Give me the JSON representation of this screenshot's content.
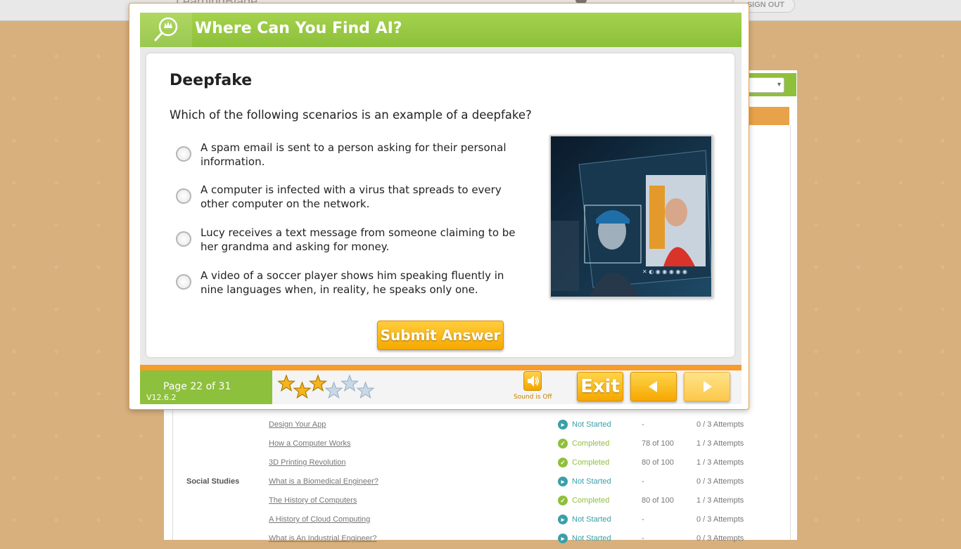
{
  "site": {
    "logo_text": "LearningBlade",
    "signout_label": "SIGN OUT"
  },
  "background_table": {
    "rows": [
      {
        "subject": "",
        "title": "Design Your App",
        "status": "Not Started",
        "status_kind": "not-started",
        "score": "-",
        "attempts": "0 / 3 Attempts"
      },
      {
        "subject": "",
        "title": "How a Computer Works",
        "status": "Completed",
        "status_kind": "completed",
        "score": "78 of 100",
        "attempts": "1 / 3 Attempts"
      },
      {
        "subject": "",
        "title": "3D Printing Revolution",
        "status": "Completed",
        "status_kind": "completed",
        "score": "80 of 100",
        "attempts": "1 / 3 Attempts"
      },
      {
        "subject": "Social Studies",
        "title": "What is a Biomedical Engineer?",
        "status": "Not Started",
        "status_kind": "not-started",
        "score": "-",
        "attempts": "0 / 3 Attempts"
      },
      {
        "subject": "",
        "title": "The History of Computers",
        "status": "Completed",
        "status_kind": "completed",
        "score": "80 of 100",
        "attempts": "1 / 3 Attempts"
      },
      {
        "subject": "",
        "title": "A History of Cloud Computing",
        "status": "Not Started",
        "status_kind": "not-started",
        "score": "-",
        "attempts": "0 / 3 Attempts"
      },
      {
        "subject": "",
        "title": "What is An Industrial Engineer?",
        "status": "Not Started",
        "status_kind": "not-started",
        "score": "-",
        "attempts": "0 / 3 Attempts"
      }
    ]
  },
  "modal": {
    "header_title": "Where Can You Find AI?",
    "header_icon": "magnifier-leaf-icon",
    "question_title": "Deepfake",
    "question_text": "Which of the following scenarios is an example of a deepfake?",
    "options": [
      "A spam email is sent to a person asking for their personal information.",
      "A computer is infected with a virus that spreads to every other computer on the network.",
      "Lucy receives a text message from someone claiming to be her grandma and asking for money.",
      "A video of a soccer player shows him speaking fluently in nine languages when, in reality, he speaks only one."
    ],
    "submit_label": "Submit Answer",
    "page_label": "Page 22 of 31",
    "version": "V12.6.2",
    "stars_filled": 3,
    "stars_total": 6,
    "sound_label": "Sound is Off",
    "exit_label": "Exit"
  },
  "colors": {
    "header_green": "#8cc03a",
    "accent_orange": "#f79b2a",
    "button_yellow": "#f7a800",
    "status_teal": "#3aa0a8",
    "status_green": "#8fc03c"
  }
}
